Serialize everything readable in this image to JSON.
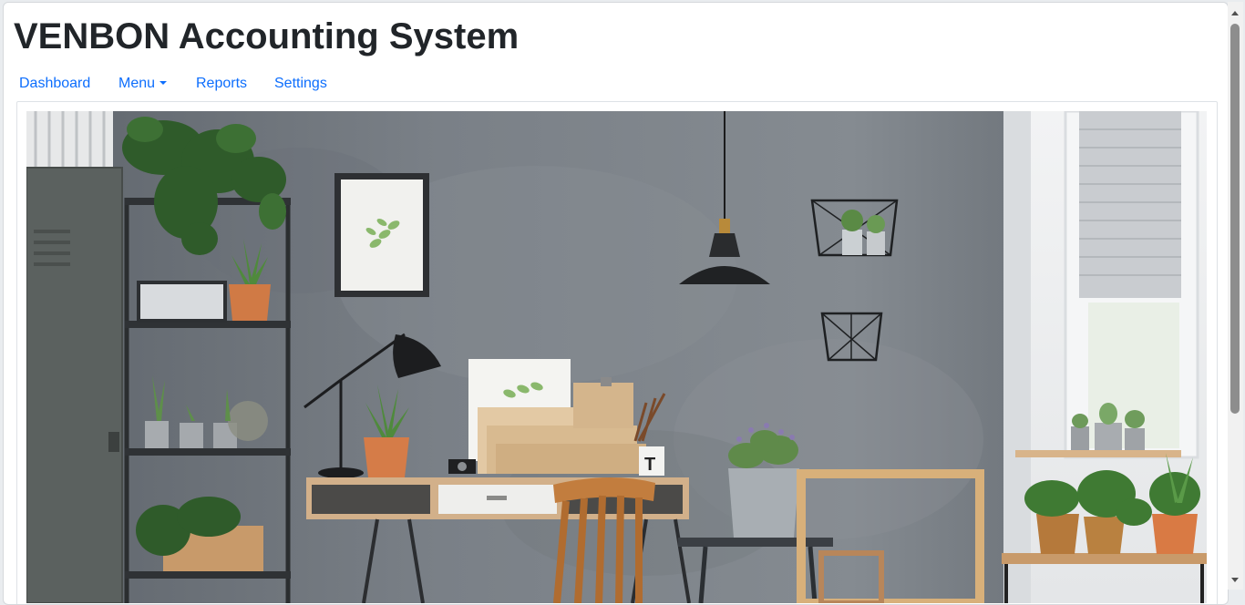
{
  "app": {
    "title": "VENBON Accounting System"
  },
  "nav": {
    "items": [
      {
        "label": "Dashboard"
      },
      {
        "label": "Menu",
        "has_dropdown": true
      },
      {
        "label": "Reports"
      },
      {
        "label": "Settings"
      }
    ]
  },
  "hero": {
    "icon": "office-interior-photo"
  },
  "colors": {
    "link": "#0d6efd",
    "title": "#212529",
    "wall": "#6e747b"
  }
}
